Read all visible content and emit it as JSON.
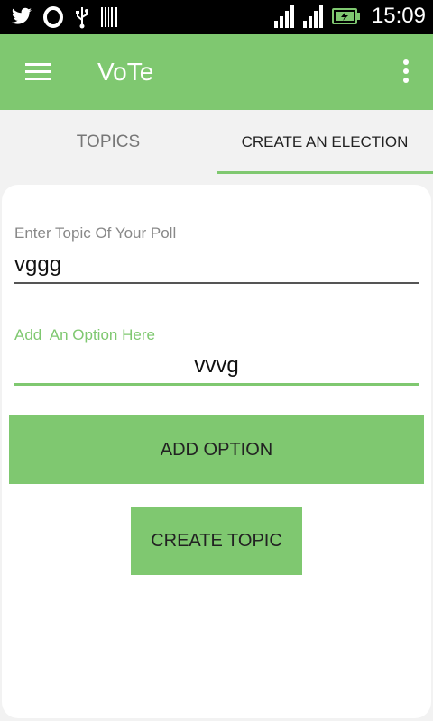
{
  "status_bar": {
    "time": "15:09",
    "left_icons": [
      "twitter-icon",
      "opera-icon",
      "usb-icon",
      "barcode-icon"
    ],
    "right_icons": [
      "signal-icon",
      "signal-icon",
      "battery-charging-icon"
    ]
  },
  "app_bar": {
    "title": "VoTe",
    "background": "#7fc870"
  },
  "tabs": [
    {
      "label": "TOPICS",
      "active": false
    },
    {
      "label": "CREATE AN ELECTION",
      "active": true
    }
  ],
  "form": {
    "topic_label": "Enter Topic Of Your Poll",
    "topic_value": "vggg",
    "option_label": "Add  An Option Here",
    "option_value": "vvvg",
    "add_option_label": "ADD OPTION",
    "create_topic_label": "CREATE TOPIC"
  }
}
